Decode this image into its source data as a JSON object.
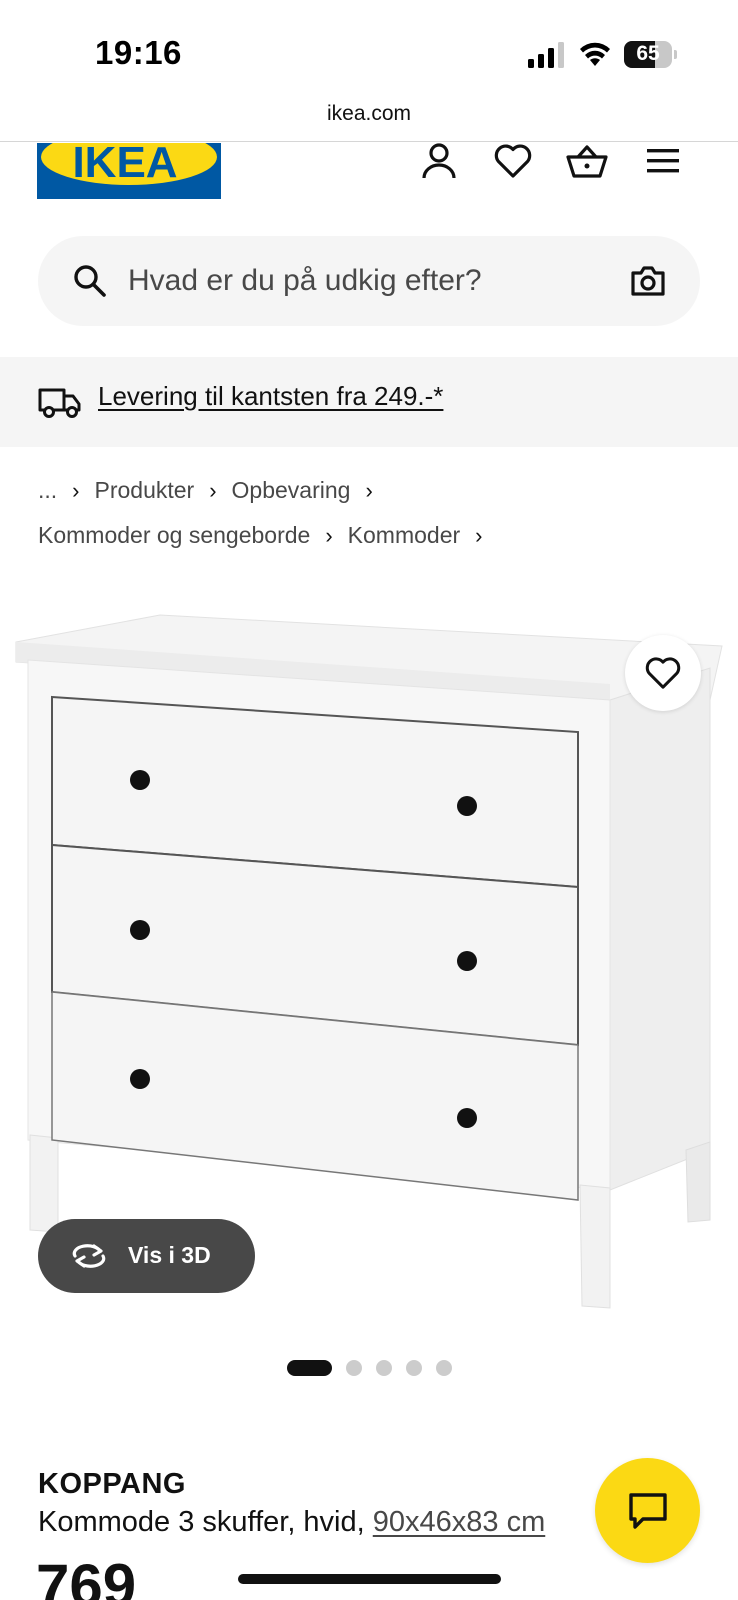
{
  "status_bar": {
    "time": "19:16",
    "battery": "65",
    "battery_level": 0.65
  },
  "browser": {
    "url": "ikea.com"
  },
  "header": {
    "logo_text": "IKEA",
    "icons": [
      "profile-icon",
      "heart-icon",
      "basket-icon",
      "menu-icon"
    ]
  },
  "search": {
    "placeholder": "Hvad er du på udkig efter?"
  },
  "delivery": {
    "text": "Levering til kantsten fra 249.-*"
  },
  "breadcrumb": {
    "row1": [
      "...",
      "Produkter",
      "Opbevaring"
    ],
    "row2": [
      "Kommoder og sengeborde",
      "Kommoder"
    ],
    "separator": "›"
  },
  "gallery": {
    "view_3d_label": "Vis i 3D",
    "dot_count": 5,
    "active_dot": 1
  },
  "product": {
    "name": "KOPPANG",
    "description": "Kommode 3 skuffer, hvid, ",
    "size": "90x46x83 cm",
    "price": "769"
  },
  "colors": {
    "ikea_blue": "#0058a3",
    "ikea_yellow": "#fbd914",
    "chat_yellow": "#fbd914",
    "button_dark": "#484848"
  }
}
